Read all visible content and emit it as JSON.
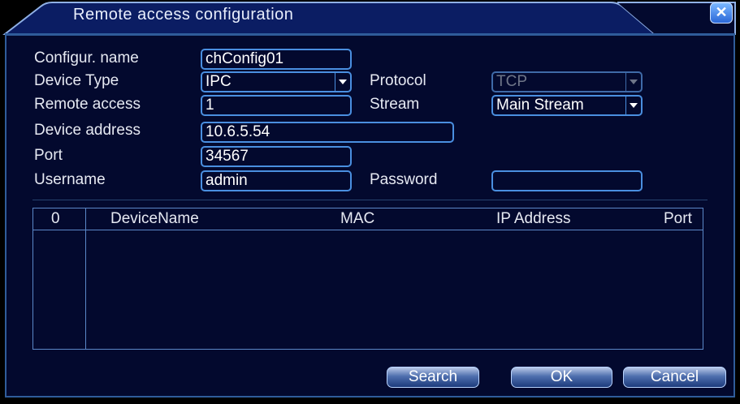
{
  "window": {
    "title": "Remote access configuration",
    "close_symbol": "✕"
  },
  "form": {
    "config_name": {
      "label": "Configur. name",
      "value": "chConfig01"
    },
    "device_type": {
      "label": "Device Type",
      "value": "IPC"
    },
    "protocol": {
      "label": "Protocol",
      "value": "TCP"
    },
    "remote_access": {
      "label": "Remote access",
      "value": "1"
    },
    "stream": {
      "label": "Stream",
      "value": "Main Stream"
    },
    "device_address": {
      "label": "Device address",
      "value": "10.6.5.54"
    },
    "port": {
      "label": "Port",
      "value": "34567"
    },
    "username": {
      "label": "Username",
      "value": "admin"
    },
    "password": {
      "label": "Password",
      "value": ""
    }
  },
  "table": {
    "columns": [
      "0",
      "DeviceName",
      "MAC",
      "IP Address",
      "Port"
    ],
    "rows": []
  },
  "buttons": {
    "search": "Search",
    "ok": "OK",
    "cancel": "Cancel"
  },
  "colors": {
    "background": "#03092e",
    "border": "#4a8fe0",
    "text": "#e6e9f2"
  }
}
